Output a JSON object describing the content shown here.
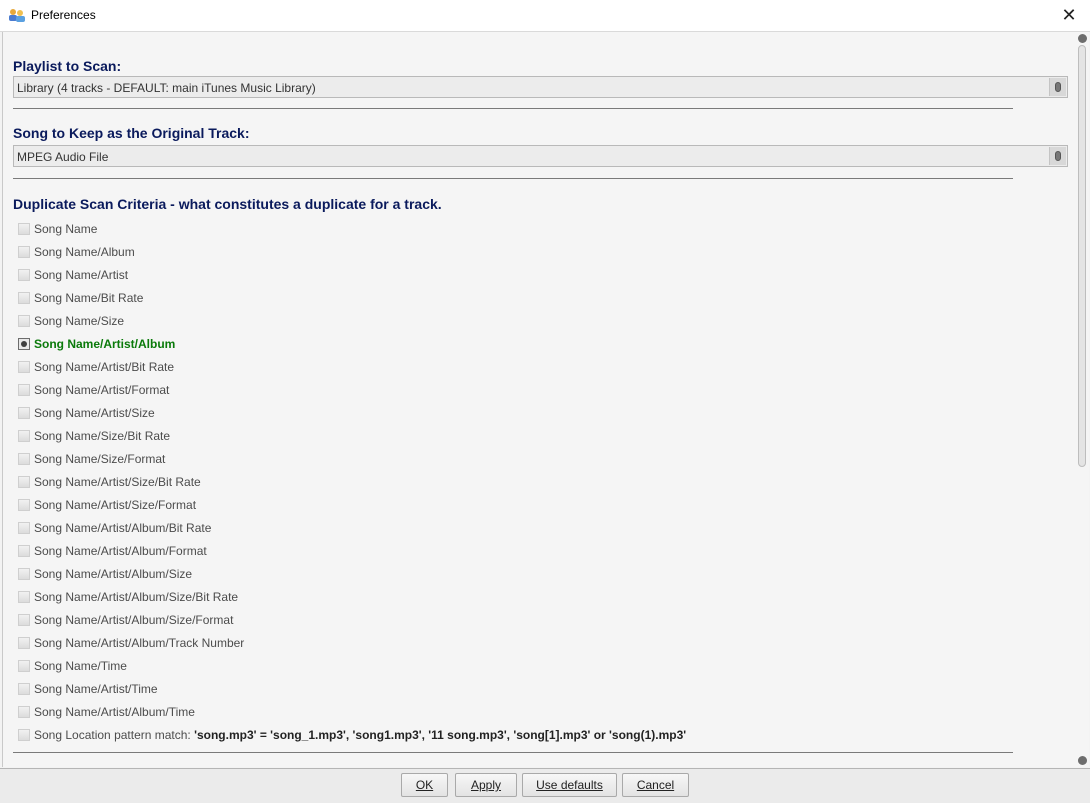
{
  "window": {
    "title": "Preferences"
  },
  "playlist": {
    "heading": "Playlist to Scan:",
    "value": "Library (4 tracks - DEFAULT: main iTunes Music Library)"
  },
  "keep": {
    "heading": "Song to Keep as the Original Track:",
    "value": "MPEG Audio File"
  },
  "criteria": {
    "heading": "Duplicate Scan Criteria - what constitutes a duplicate for a track.",
    "items": [
      {
        "label": "Song Name",
        "checked": false
      },
      {
        "label": "Song Name/Album",
        "checked": false
      },
      {
        "label": "Song Name/Artist",
        "checked": false
      },
      {
        "label": "Song Name/Bit Rate",
        "checked": false
      },
      {
        "label": "Song Name/Size",
        "checked": false
      },
      {
        "label": "Song Name/Artist/Album",
        "checked": true
      },
      {
        "label": "Song Name/Artist/Bit Rate",
        "checked": false
      },
      {
        "label": "Song Name/Artist/Format",
        "checked": false
      },
      {
        "label": "Song Name/Artist/Size",
        "checked": false
      },
      {
        "label": "Song Name/Size/Bit Rate",
        "checked": false
      },
      {
        "label": "Song Name/Size/Format",
        "checked": false
      },
      {
        "label": "Song Name/Artist/Size/Bit Rate",
        "checked": false
      },
      {
        "label": "Song Name/Artist/Size/Format",
        "checked": false
      },
      {
        "label": "Song Name/Artist/Album/Bit Rate",
        "checked": false
      },
      {
        "label": "Song Name/Artist/Album/Format",
        "checked": false
      },
      {
        "label": "Song Name/Artist/Album/Size",
        "checked": false
      },
      {
        "label": "Song Name/Artist/Album/Size/Bit Rate",
        "checked": false
      },
      {
        "label": "Song Name/Artist/Album/Size/Format",
        "checked": false
      },
      {
        "label": "Song Name/Artist/Album/Track Number",
        "checked": false
      },
      {
        "label": "Song Name/Time",
        "checked": false
      },
      {
        "label": "Song Name/Artist/Time",
        "checked": false
      },
      {
        "label": "Song Name/Artist/Album/Time",
        "checked": false
      }
    ],
    "location": {
      "prefix": "Song Location pattern match: ",
      "pattern": "'song.mp3' = 'song_1.mp3', 'song1.mp3', '11 song.mp3', 'song[1].mp3' or 'song(1).mp3'",
      "checked": false
    }
  },
  "buttons": {
    "ok": "OK",
    "apply": "Apply",
    "defaults": "Use defaults",
    "cancel": "Cancel"
  },
  "icons": {
    "app": "preferences-users-icon",
    "close": "close-icon",
    "dropdown": "dropdown-knob-icon"
  }
}
